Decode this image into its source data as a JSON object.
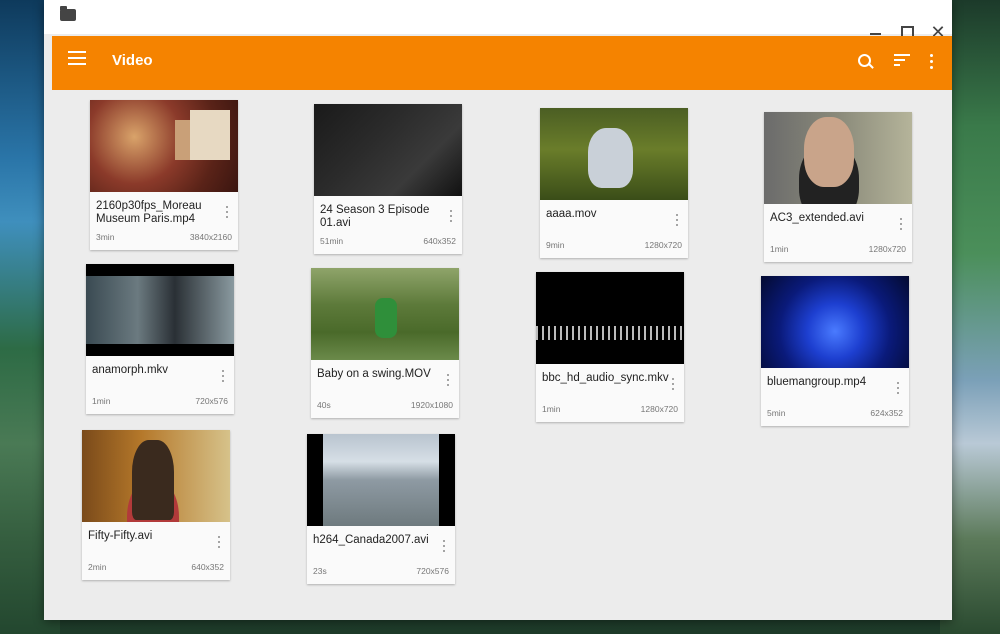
{
  "window": {
    "title": "Video"
  },
  "toolbar": {
    "title": "Video",
    "icons": [
      "menu-icon",
      "search-icon",
      "sort-icon",
      "more-vert-icon"
    ]
  },
  "colors": {
    "accent": "#f58300",
    "background": "#ececec",
    "card": "#fafafa"
  },
  "videos": [
    {
      "title": "2160p30fps_Moreau Museum Paris.mp4",
      "duration": "3min",
      "resolution": "3840x2160"
    },
    {
      "title": "24 Season 3 Episode 01.avi",
      "duration": "51min",
      "resolution": "640x352"
    },
    {
      "title": "aaaa.mov",
      "duration": "9min",
      "resolution": "1280x720"
    },
    {
      "title": "AC3_extended.avi",
      "duration": "1min",
      "resolution": "1280x720"
    },
    {
      "title": "anamorph.mkv",
      "duration": "1min",
      "resolution": "720x576"
    },
    {
      "title": "Baby on a swing.MOV",
      "duration": "40s",
      "resolution": "1920x1080"
    },
    {
      "title": "bbc_hd_audio_sync.mkv",
      "duration": "1min",
      "resolution": "1280x720"
    },
    {
      "title": "bluemangroup.mp4",
      "duration": "5min",
      "resolution": "624x352"
    },
    {
      "title": "Fifty-Fifty.avi",
      "duration": "2min",
      "resolution": "640x352"
    },
    {
      "title": "h264_Canada2007.avi",
      "duration": "23s",
      "resolution": "720x576"
    }
  ]
}
